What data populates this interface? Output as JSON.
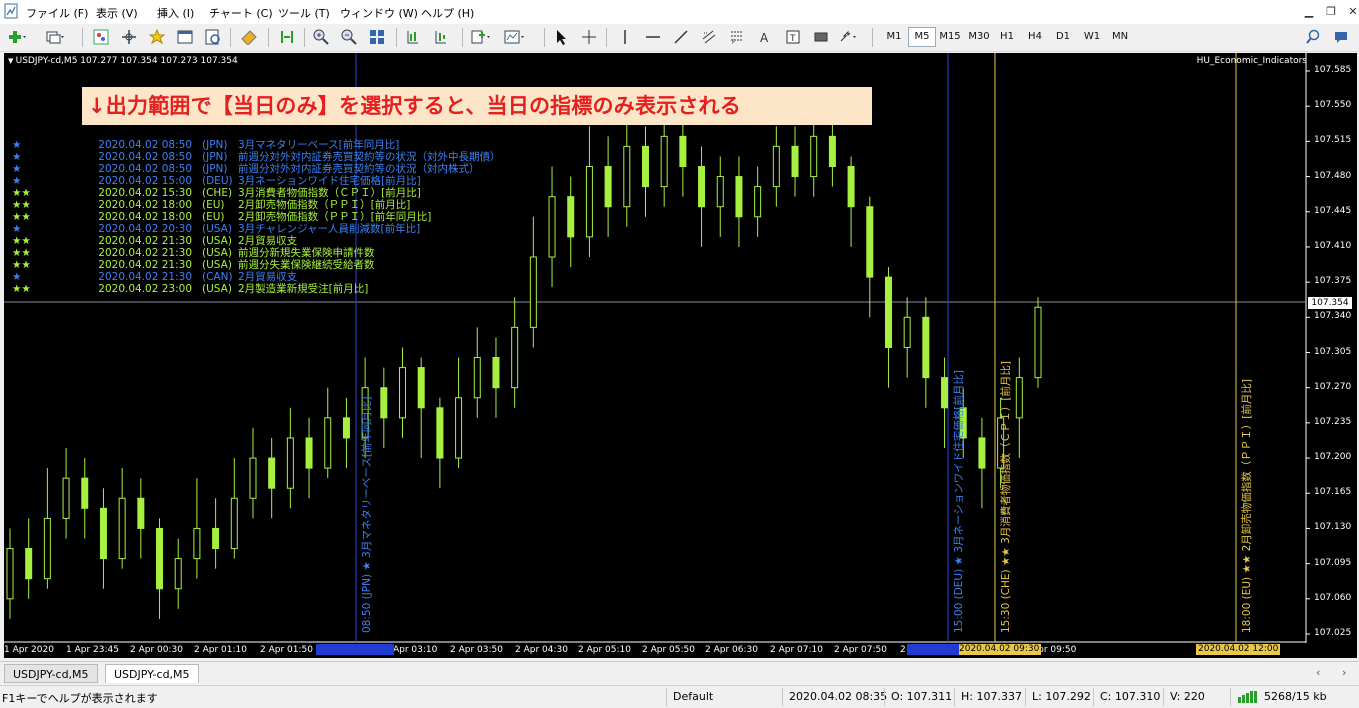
{
  "menu": [
    "ファイル (F)",
    "表示 (V)",
    "挿入 (I)",
    "チャート (C)",
    "ツール (T)",
    "ウィンドウ (W)",
    "ヘルプ (H)"
  ],
  "timeframes": [
    "M1",
    "M5",
    "M15",
    "M30",
    "H1",
    "H4",
    "D1",
    "W1",
    "MN"
  ],
  "active_timeframe": "M5",
  "chart": {
    "title": "USDJPY-cd,M5  107.277 107.354 107.273 107.354",
    "indicator": "HU_Economic_Indicators",
    "current_price": "107.354",
    "price_labels": [
      "107.585",
      "107.550",
      "107.515",
      "107.480",
      "107.445",
      "107.410",
      "107.375",
      "107.340",
      "107.305",
      "107.270",
      "107.235",
      "107.200",
      "107.165",
      "107.130",
      "107.095",
      "107.060",
      "107.025"
    ],
    "time_labels": [
      "1 Apr 2020",
      "1 Apr 23:45",
      "2 Apr 00:30",
      "2 Apr 01:10",
      "2 Apr 01:50",
      "Apr 03:10",
      "2 Apr 03:50",
      "2 Apr 04:30",
      "2 Apr 05:10",
      "2 Apr 05:50",
      "2 Apr 06:30",
      "2 Apr 07:10",
      "2 Apr 07:50",
      "2",
      "Apr 09:50"
    ],
    "time_highlights": [
      "2020.04.02 09:30",
      "2020.04.02 12:00"
    ],
    "banner": "↓出力範囲で【当日のみ】を選択すると、当日の指標のみ表示される",
    "colors": {
      "blue": "#3b82f6",
      "green": "#a8f040",
      "yellow": "#e8c84a",
      "bull": "#000000",
      "bear": "#a8f040"
    }
  },
  "events": [
    {
      "stars": "★",
      "time": "2020.04.02 08:50",
      "country": "(JPN)",
      "name": "3月マネタリーベース[前年同月比]",
      "level": 1
    },
    {
      "stars": "★",
      "time": "2020.04.02 08:50",
      "country": "(JPN)",
      "name": "前週分対外対内証券売買契約等の状況（対外中長期債）",
      "level": 1
    },
    {
      "stars": "★",
      "time": "2020.04.02 08:50",
      "country": "(JPN)",
      "name": "前週分対外対内証券売買契約等の状況（対内株式）",
      "level": 1
    },
    {
      "stars": "★",
      "time": "2020.04.02 15:00",
      "country": "(DEU)",
      "name": "3月ネーションワイド住宅価格[前月比]",
      "level": 1
    },
    {
      "stars": "★★",
      "time": "2020.04.02 15:30",
      "country": "(CHE)",
      "name": "3月消費者物価指数（ＣＰＩ）[前月比]",
      "level": 2
    },
    {
      "stars": "★★",
      "time": "2020.04.02 18:00",
      "country": "(EU)",
      "name": "2月卸売物価指数（ＰＰＩ）[前月比]",
      "level": 2
    },
    {
      "stars": "★★",
      "time": "2020.04.02 18:00",
      "country": "(EU)",
      "name": "2月卸売物価指数（ＰＰＩ）[前年同月比]",
      "level": 2
    },
    {
      "stars": "★",
      "time": "2020.04.02 20:30",
      "country": "(USA)",
      "name": "3月チャレンジャー人員削減数[前年比]",
      "level": 1
    },
    {
      "stars": "★★",
      "time": "2020.04.02 21:30",
      "country": "(USA)",
      "name": "2月貿易収支",
      "level": 2
    },
    {
      "stars": "★★",
      "time": "2020.04.02 21:30",
      "country": "(USA)",
      "name": "前週分新規失業保険申請件数",
      "level": 2
    },
    {
      "stars": "★★",
      "time": "2020.04.02 21:30",
      "country": "(USA)",
      "name": "前週分失業保険継続受給者数",
      "level": 2
    },
    {
      "stars": "★",
      "time": "2020.04.02 21:30",
      "country": "(CAN)",
      "name": "2月貿易収支",
      "level": 1
    },
    {
      "stars": "★★",
      "time": "2020.04.02 23:00",
      "country": "(USA)",
      "name": "2月製造業新規受注[前月比]",
      "level": 2
    }
  ],
  "vlines": [
    {
      "text": "08:50 (JPN) ★  3月マネタリーベース[前年同月比]",
      "color": "blue"
    },
    {
      "text": "15:00 (DEU) ★  3月ネーションワイド住宅価格[前月比]",
      "color": "blue"
    },
    {
      "text": "15:30 (CHE) ★★  3月消費者物価指数（ＣＰＩ）[前月比]",
      "color": "yellow"
    },
    {
      "text": "18:00 (EU) ★★  2月卸売物価指数（ＰＰＩ）[前月比]",
      "color": "yellow"
    }
  ],
  "candles": [
    {
      "o": 107.06,
      "c": 107.11,
      "h": 107.13,
      "l": 107.04
    },
    {
      "o": 107.11,
      "c": 107.08,
      "h": 107.14,
      "l": 107.06
    },
    {
      "o": 107.08,
      "c": 107.14,
      "h": 107.19,
      "l": 107.07
    },
    {
      "o": 107.14,
      "c": 107.18,
      "h": 107.21,
      "l": 107.12
    },
    {
      "o": 107.18,
      "c": 107.15,
      "h": 107.2,
      "l": 107.12
    },
    {
      "o": 107.15,
      "c": 107.1,
      "h": 107.17,
      "l": 107.07
    },
    {
      "o": 107.1,
      "c": 107.16,
      "h": 107.19,
      "l": 107.09
    },
    {
      "o": 107.16,
      "c": 107.13,
      "h": 107.18,
      "l": 107.1
    },
    {
      "o": 107.13,
      "c": 107.07,
      "h": 107.14,
      "l": 107.04
    },
    {
      "o": 107.07,
      "c": 107.1,
      "h": 107.12,
      "l": 107.05
    },
    {
      "o": 107.1,
      "c": 107.13,
      "h": 107.18,
      "l": 107.08
    },
    {
      "o": 107.13,
      "c": 107.11,
      "h": 107.16,
      "l": 107.09
    },
    {
      "o": 107.11,
      "c": 107.16,
      "h": 107.2,
      "l": 107.1
    },
    {
      "o": 107.16,
      "c": 107.2,
      "h": 107.23,
      "l": 107.14
    },
    {
      "o": 107.2,
      "c": 107.17,
      "h": 107.22,
      "l": 107.14
    },
    {
      "o": 107.17,
      "c": 107.22,
      "h": 107.25,
      "l": 107.15
    },
    {
      "o": 107.22,
      "c": 107.19,
      "h": 107.24,
      "l": 107.16
    },
    {
      "o": 107.19,
      "c": 107.24,
      "h": 107.27,
      "l": 107.18
    },
    {
      "o": 107.24,
      "c": 107.22,
      "h": 107.26,
      "l": 107.19
    },
    {
      "o": 107.22,
      "c": 107.27,
      "h": 107.3,
      "l": 107.2
    },
    {
      "o": 107.27,
      "c": 107.24,
      "h": 107.29,
      "l": 107.21
    },
    {
      "o": 107.24,
      "c": 107.29,
      "h": 107.31,
      "l": 107.22
    },
    {
      "o": 107.29,
      "c": 107.25,
      "h": 107.3,
      "l": 107.2
    },
    {
      "o": 107.25,
      "c": 107.2,
      "h": 107.26,
      "l": 107.17
    },
    {
      "o": 107.2,
      "c": 107.26,
      "h": 107.3,
      "l": 107.19
    },
    {
      "o": 107.26,
      "c": 107.3,
      "h": 107.33,
      "l": 107.24
    },
    {
      "o": 107.3,
      "c": 107.27,
      "h": 107.32,
      "l": 107.24
    },
    {
      "o": 107.27,
      "c": 107.33,
      "h": 107.36,
      "l": 107.25
    },
    {
      "o": 107.33,
      "c": 107.4,
      "h": 107.44,
      "l": 107.31
    },
    {
      "o": 107.4,
      "c": 107.46,
      "h": 107.49,
      "l": 107.37
    },
    {
      "o": 107.46,
      "c": 107.42,
      "h": 107.48,
      "l": 107.39
    },
    {
      "o": 107.42,
      "c": 107.49,
      "h": 107.53,
      "l": 107.4
    },
    {
      "o": 107.49,
      "c": 107.45,
      "h": 107.52,
      "l": 107.42
    },
    {
      "o": 107.45,
      "c": 107.51,
      "h": 107.55,
      "l": 107.43
    },
    {
      "o": 107.51,
      "c": 107.47,
      "h": 107.53,
      "l": 107.44
    },
    {
      "o": 107.47,
      "c": 107.52,
      "h": 107.54,
      "l": 107.45
    },
    {
      "o": 107.52,
      "c": 107.49,
      "h": 107.54,
      "l": 107.46
    },
    {
      "o": 107.49,
      "c": 107.45,
      "h": 107.51,
      "l": 107.41
    },
    {
      "o": 107.45,
      "c": 107.48,
      "h": 107.5,
      "l": 107.42
    },
    {
      "o": 107.48,
      "c": 107.44,
      "h": 107.5,
      "l": 107.41
    },
    {
      "o": 107.44,
      "c": 107.47,
      "h": 107.49,
      "l": 107.42
    },
    {
      "o": 107.47,
      "c": 107.51,
      "h": 107.53,
      "l": 107.45
    },
    {
      "o": 107.51,
      "c": 107.48,
      "h": 107.53,
      "l": 107.46
    },
    {
      "o": 107.48,
      "c": 107.52,
      "h": 107.55,
      "l": 107.46
    },
    {
      "o": 107.52,
      "c": 107.49,
      "h": 107.54,
      "l": 107.47
    },
    {
      "o": 107.49,
      "c": 107.45,
      "h": 107.5,
      "l": 107.41
    },
    {
      "o": 107.45,
      "c": 107.38,
      "h": 107.46,
      "l": 107.34
    },
    {
      "o": 107.38,
      "c": 107.31,
      "h": 107.39,
      "l": 107.27
    },
    {
      "o": 107.31,
      "c": 107.34,
      "h": 107.36,
      "l": 107.28
    },
    {
      "o": 107.34,
      "c": 107.28,
      "h": 107.36,
      "l": 107.25
    },
    {
      "o": 107.28,
      "c": 107.25,
      "h": 107.3,
      "l": 107.21
    },
    {
      "o": 107.25,
      "c": 107.22,
      "h": 107.27,
      "l": 107.2
    },
    {
      "o": 107.22,
      "c": 107.19,
      "h": 107.24,
      "l": 107.15
    },
    {
      "o": 107.19,
      "c": 107.24,
      "h": 107.26,
      "l": 107.17
    },
    {
      "o": 107.24,
      "c": 107.28,
      "h": 107.3,
      "l": 107.2
    },
    {
      "o": 107.28,
      "c": 107.35,
      "h": 107.36,
      "l": 107.27
    }
  ]
}
